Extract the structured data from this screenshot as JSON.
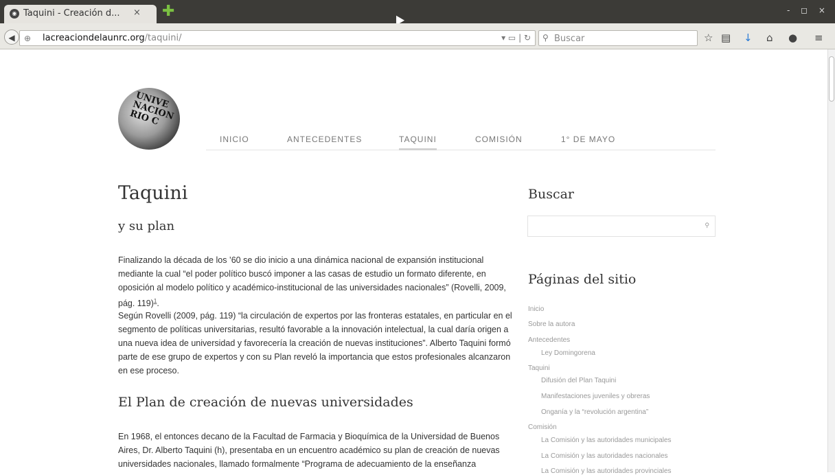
{
  "browser": {
    "tab_title": "Taquini - Creación d...",
    "tab_close": "×",
    "new_tab": "✚",
    "url_domain": "lacreaciondelaunrc.org",
    "url_path": "/taquini/",
    "search_placeholder": "Buscar",
    "window_controls": "- ◻ ×"
  },
  "site": {
    "nav": [
      "INICIO",
      "ANTECEDENTES",
      "TAQUINI",
      "COMISIÓN",
      "1° DE MAYO"
    ],
    "active_nav": "TAQUINI",
    "logo_text": "UNIVE NACION RIO C"
  },
  "article": {
    "title": "Taquini",
    "subtitle": "y su plan",
    "p1": "Finalizando la década de los ’60 se dio inicio a una dinámica nacional de expansión institucional mediante la cual “el poder político buscó imponer a las casas de estudio un formato diferente, en oposición al modelo político y académico-institucional de las universidades nacionales” (Rovelli, 2009, pág. 119)",
    "p1_footnote": "1",
    "p1_end": ".",
    "p2": "Según Rovelli (2009, pág. 119) “la circulación de expertos por las fronteras estatales, en particular en el segmento de políticas universitarias, resultó favorable a la innovación intelectual, la cual daría origen a una nueva idea de universidad y favorecería la creación de nuevas instituciones”. Alberto Taquini formó parte de ese grupo de expertos y con su Plan reveló la importancia que estos profesionales alcanzaron en ese proceso.",
    "section_heading": "El Plan de creación de nuevas universidades",
    "p3": "En 1968, el entonces decano de la Facultad de Farmacia y Bioquímica de la Universidad de Buenos Aires, Dr. Alberto Taquini (h), presentaba en un encuentro académico su plan de creación de nuevas universidades nacionales, llamado formalmente “Programa de adecuamiento de la enseñanza"
  },
  "sidebar": {
    "search_heading": "Buscar",
    "pages_heading": "Páginas del sitio",
    "pages": [
      {
        "label": "Inicio",
        "level": 0
      },
      {
        "label": "Sobre la autora",
        "level": 0
      },
      {
        "label": "Antecedentes",
        "level": 0
      },
      {
        "label": "Ley Domingorena",
        "level": 1
      },
      {
        "label": "Taquini",
        "level": 0
      },
      {
        "label": "Difusión del Plan Taquini",
        "level": 1
      },
      {
        "label": "Manifestaciones juveniles y obreras",
        "level": 1
      },
      {
        "label": "Onganía y la “revolución argentina”",
        "level": 1
      },
      {
        "label": "Comisión",
        "level": 0
      },
      {
        "label": "La Comisión y las autoridades municipales",
        "level": 1
      },
      {
        "label": "La Comisión y las autoridades nacionales",
        "level": 1
      },
      {
        "label": "La Comisión y las autoridades provinciales",
        "level": 1
      }
    ]
  }
}
